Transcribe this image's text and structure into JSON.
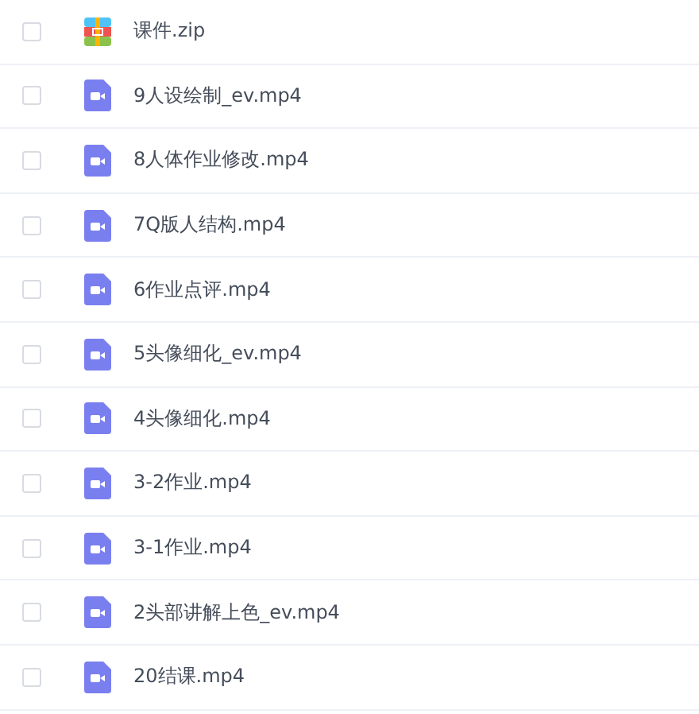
{
  "files": [
    {
      "name": "课件.zip",
      "kind": "zip",
      "checked": false
    },
    {
      "name": "9人设绘制_ev.mp4",
      "kind": "video",
      "checked": false
    },
    {
      "name": "8人体作业修改.mp4",
      "kind": "video",
      "checked": false
    },
    {
      "name": "7Q版人结构.mp4",
      "kind": "video",
      "checked": false
    },
    {
      "name": "6作业点评.mp4",
      "kind": "video",
      "checked": false
    },
    {
      "name": "5头像细化_ev.mp4",
      "kind": "video",
      "checked": false
    },
    {
      "name": "4头像细化.mp4",
      "kind": "video",
      "checked": false
    },
    {
      "name": "3-2作业.mp4",
      "kind": "video",
      "checked": false
    },
    {
      "name": "3-1作业.mp4",
      "kind": "video",
      "checked": false
    },
    {
      "name": "2头部讲解上色_ev.mp4",
      "kind": "video",
      "checked": false
    },
    {
      "name": "20结课.mp4",
      "kind": "video",
      "checked": false
    }
  ]
}
